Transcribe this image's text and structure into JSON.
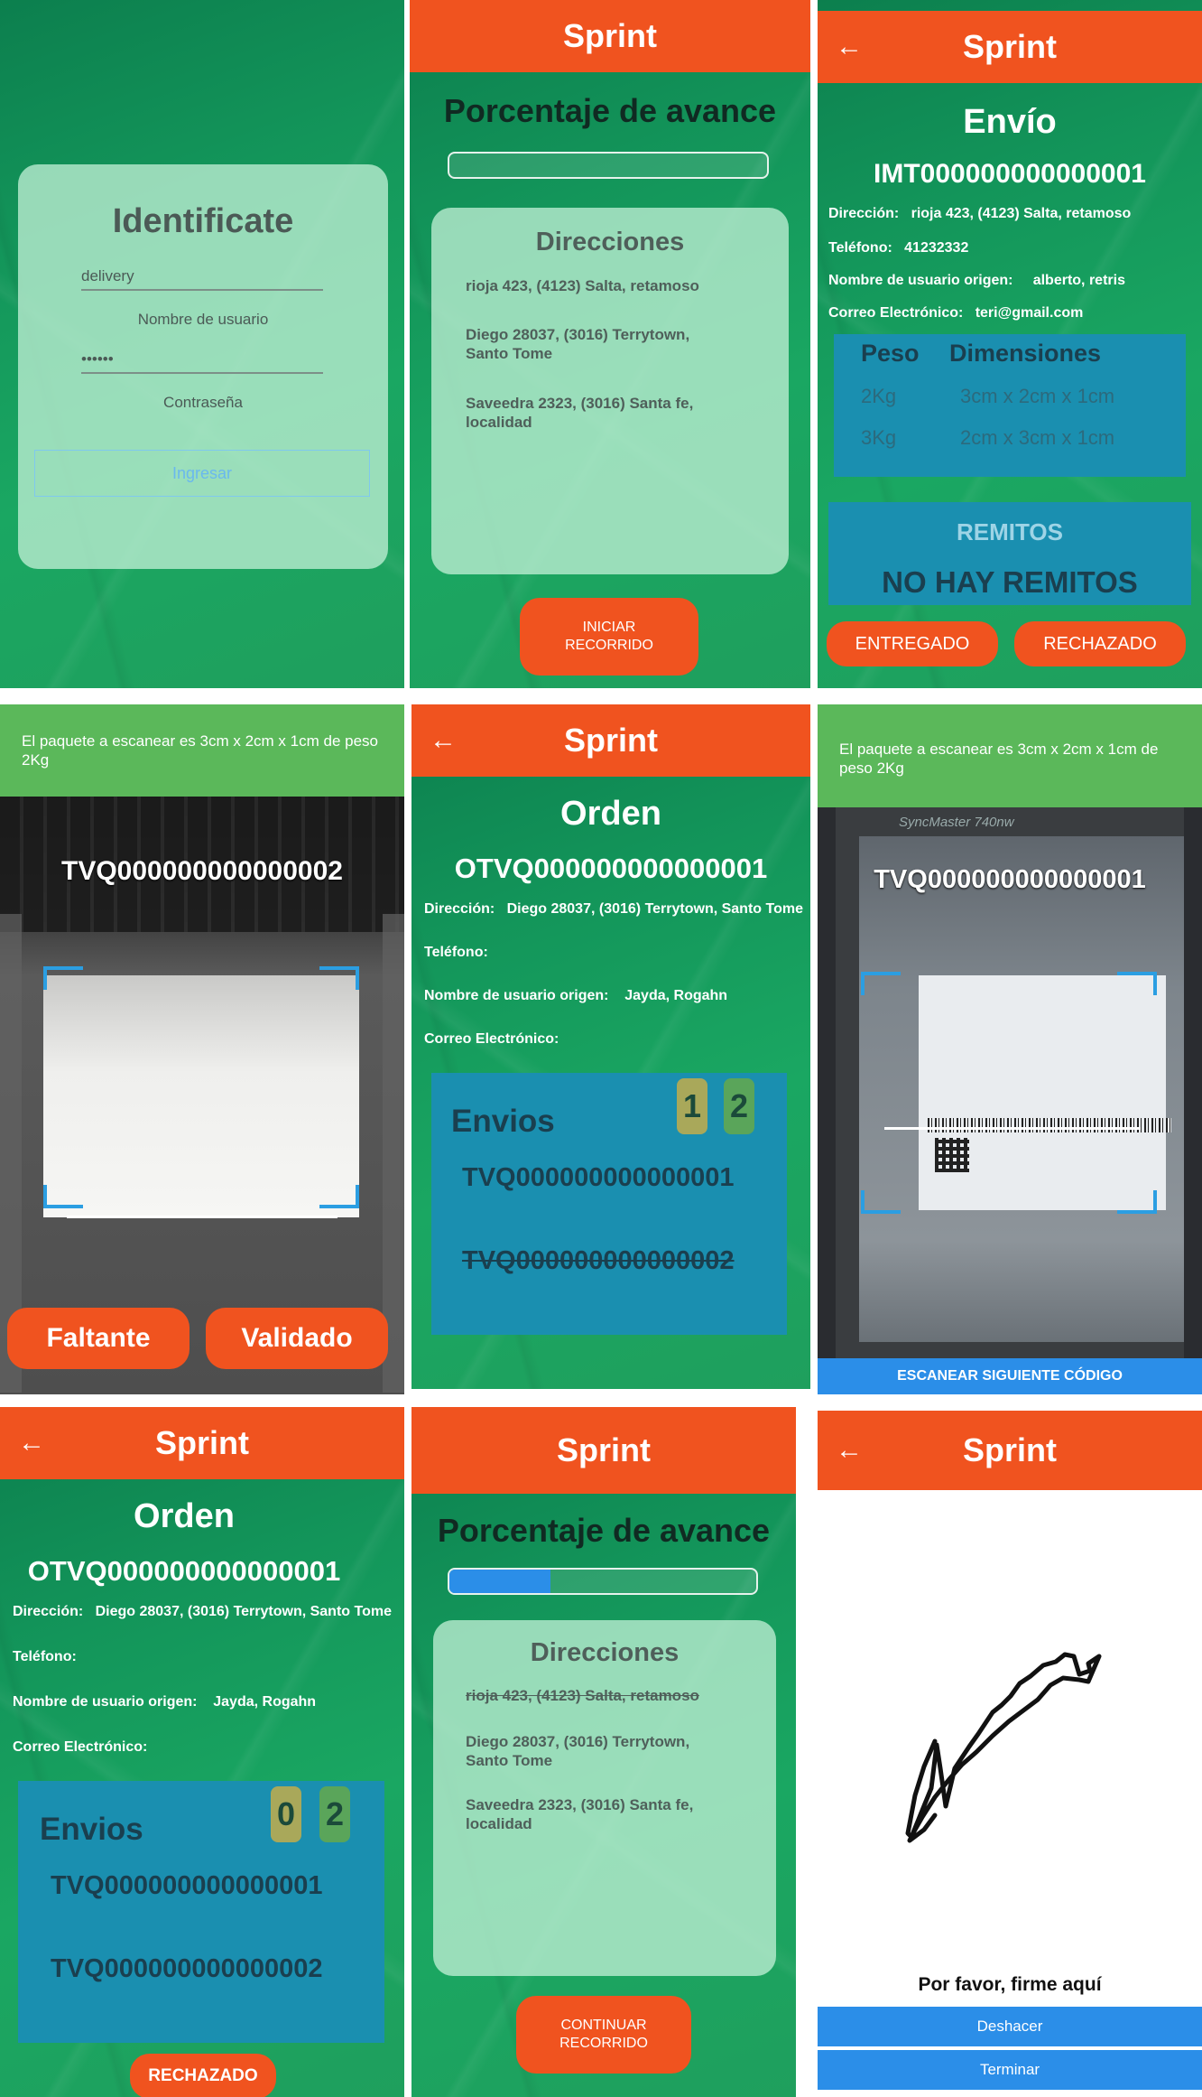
{
  "app_title": "Sprint",
  "colors": {
    "primary_orange": "#f0531f",
    "green": "#5bb85a",
    "blue": "#2b8ee8",
    "progress_blue": "#2b8ee8"
  },
  "login": {
    "title": "Identificate",
    "username_value": "delivery",
    "username_label": "Nombre de usuario",
    "password_value": "••••••",
    "password_label": "Contraseña",
    "submit": "Ingresar"
  },
  "progress1": {
    "title": "Porcentaje de avance",
    "progress": 0,
    "section_title": "Direcciones",
    "addresses": [
      "rioja 423, (4123) Salta, retamoso",
      "Diego 28037, (3016) Terrytown, Santo Tome",
      "Saveedra  2323, (3016) Santa fe, localidad"
    ],
    "button": "INICIAR RECORRIDO"
  },
  "envio": {
    "title": "Envío",
    "code": "IMT000000000000001",
    "fields": [
      {
        "label": "Dirección:",
        "value": "rioja 423, (4123) Salta, retamoso"
      },
      {
        "label": "Teléfono:",
        "value": "41232332"
      },
      {
        "label": "Nombre de usuario origen:",
        "value": "alberto, retris"
      },
      {
        "label": "Correo Electrónico:",
        "value": "teri@gmail.com"
      }
    ],
    "table_headers": [
      "Peso",
      "Dimensiones"
    ],
    "rows": [
      {
        "peso": "2Kg",
        "dim": "3cm x 2cm x 1cm"
      },
      {
        "peso": "3Kg",
        "dim": "2cm x 3cm x 1cm"
      }
    ],
    "remitos_title": "REMITOS",
    "remitos_empty": "NO HAY REMITOS",
    "btn_ok": "ENTREGADO",
    "btn_reject": "RECHAZADO"
  },
  "scan1": {
    "header": "El paquete a escanear es 3cm x 2cm x 1cm de peso 2Kg",
    "code": "TVQ000000000000002",
    "btn_missing": "Faltante",
    "btn_valid": "Validado"
  },
  "orden1": {
    "title": "Orden",
    "code": "OTVQ000000000000001",
    "fields": [
      {
        "label": "Dirección:",
        "value": "Diego 28037, (3016) Terrytown, Santo Tome"
      },
      {
        "label": "Teléfono:",
        "value": ""
      },
      {
        "label": "Nombre de usuario origen:",
        "value": "Jayda, Rogahn"
      },
      {
        "label": "Correo Electrónico:",
        "value": ""
      }
    ],
    "envios_title": "Envios",
    "count_a": "1",
    "count_b": "2",
    "items": [
      "TVQ000000000000001",
      "TVQ000000000000002"
    ]
  },
  "scan2": {
    "header": "El paquete a escanear es 3cm x 2cm x 1cm de peso 2Kg",
    "code": "TVQ000000000000001",
    "monitor_brand": "SyncMaster 740nw",
    "button": "ESCANEAR SIGUIENTE CÓDIGO"
  },
  "orden2": {
    "title": "Orden",
    "code": "OTVQ000000000000001",
    "fields": [
      {
        "label": "Dirección:",
        "value": "Diego 28037, (3016) Terrytown, Santo Tome"
      },
      {
        "label": "Teléfono:",
        "value": ""
      },
      {
        "label": "Nombre de usuario origen:",
        "value": "Jayda, Rogahn"
      },
      {
        "label": "Correo Electrónico:",
        "value": ""
      }
    ],
    "envios_title": "Envios",
    "count_a": "0",
    "count_b": "2",
    "items": [
      "TVQ000000000000001",
      "TVQ000000000000002"
    ],
    "button": "RECHAZADO"
  },
  "progress2": {
    "title": "Porcentaje de avance",
    "progress": 0.33,
    "section_title": "Direcciones",
    "addresses": [
      "rioja 423, (4123) Salta, retamoso",
      "Diego 28037, (3016) Terrytown, Santo Tome",
      "Saveedra  2323, (3016) Santa fe, localidad"
    ],
    "button": "CONTINUAR RECORRIDO"
  },
  "firma": {
    "prompt": "Por favor, firme aquí",
    "btn_undo": "Deshacer",
    "btn_finish": "Terminar"
  }
}
